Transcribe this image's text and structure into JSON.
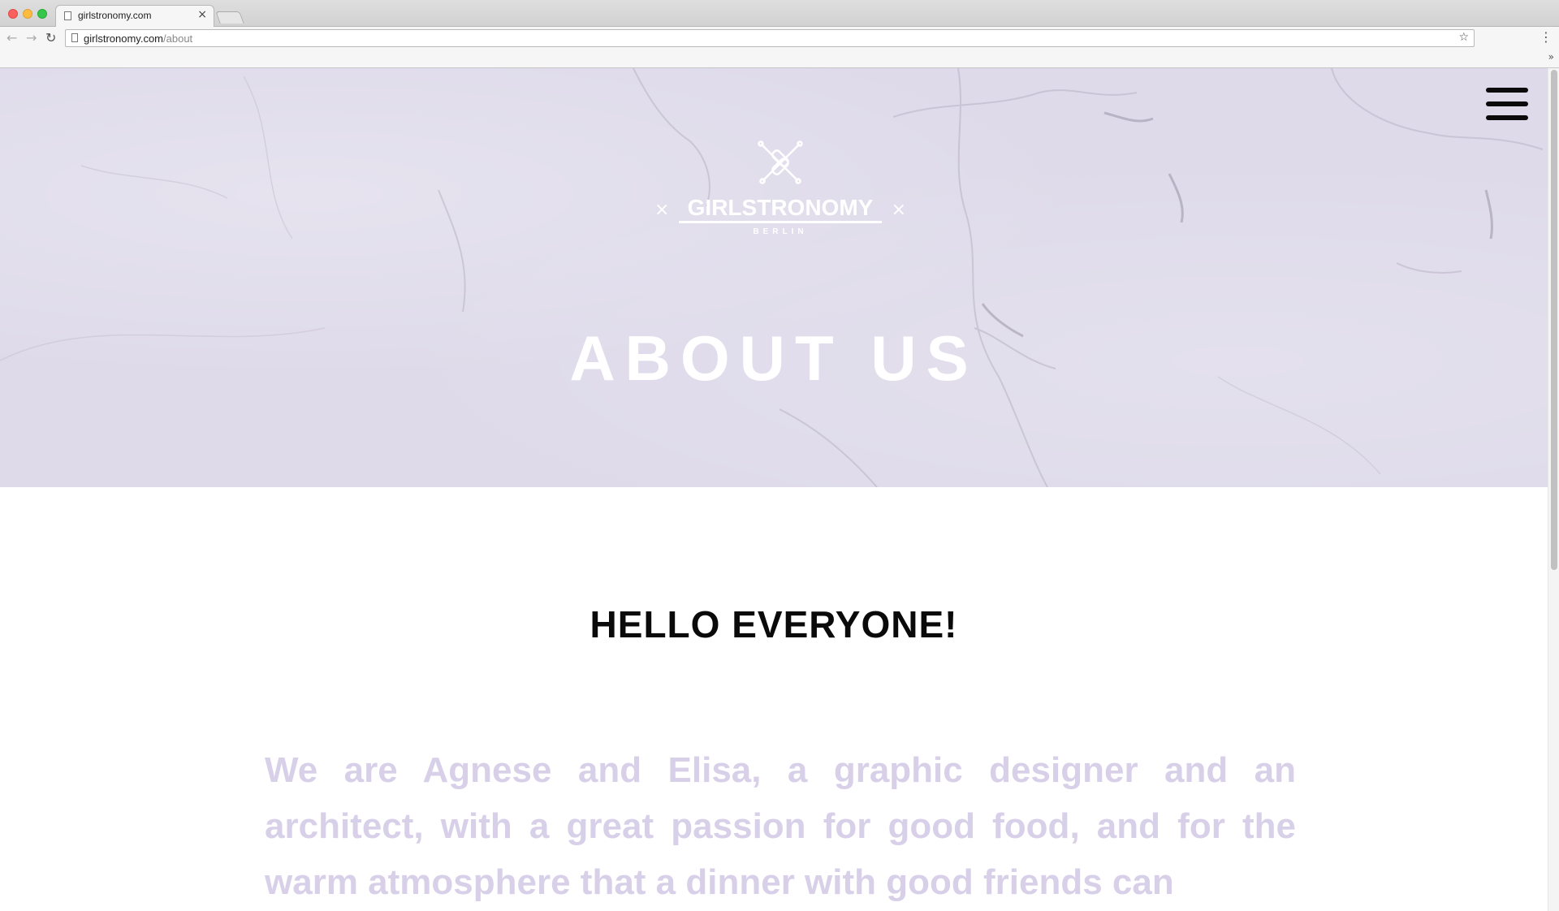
{
  "browser": {
    "tab_title": "girlstronomy.com",
    "tab_close": "×",
    "url_host": "girlstronomy.com",
    "url_path": "/about",
    "icons": {
      "back": "back-arrow-icon",
      "forward": "forward-arrow-icon",
      "reload": "reload-icon",
      "star": "star-icon",
      "menu": "vertical-dots-icon"
    }
  },
  "site": {
    "logo_name": "GIRLSTRONOMY",
    "logo_sub": "BERLIN",
    "logo_ornament": "×",
    "hero_title": "ABOUT US",
    "section_heading": "HELLO EVERYONE!",
    "intro_text": "We are Agnese and Elisa, a graphic designer and an architect, with a great passion for good food, and for the warm atmosphere that a dinner with good friends can",
    "colors": {
      "hero_bg": "#dedaea",
      "intro_text": "#d8d0e8",
      "heading": "#0a0a0a"
    }
  }
}
